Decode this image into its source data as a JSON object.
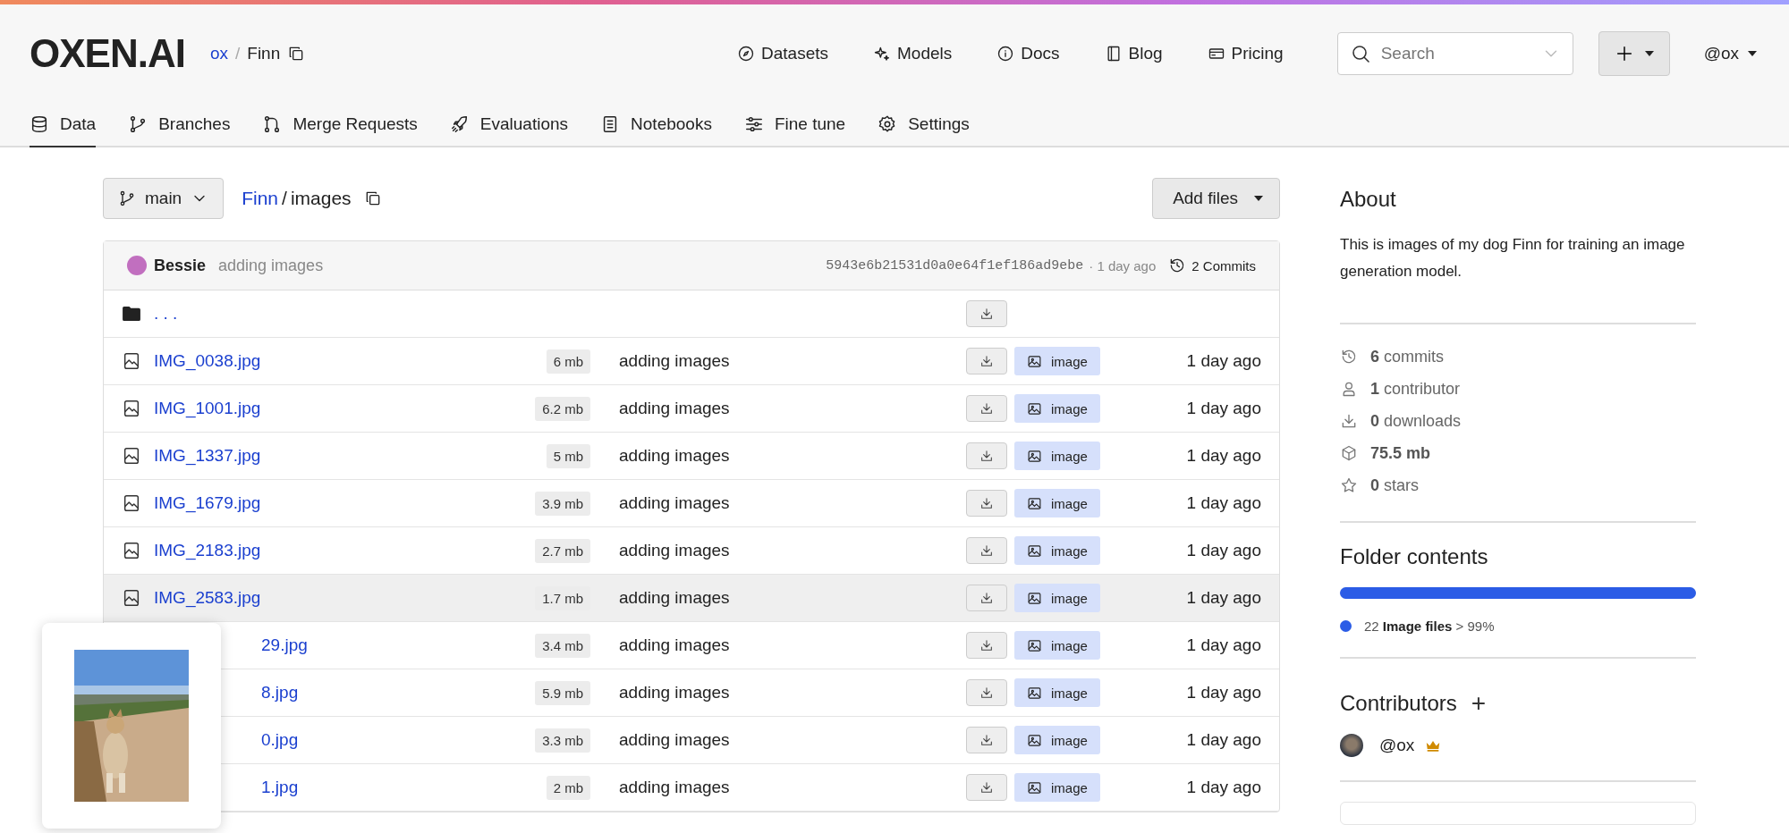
{
  "header": {
    "logo": "OXEN.AI",
    "breadcrumb": {
      "owner": "ox",
      "separator": "/",
      "repo": "Finn"
    },
    "nav": [
      {
        "kind": "compass",
        "label": "Datasets"
      },
      {
        "kind": "sparkle",
        "label": "Models"
      },
      {
        "kind": "info",
        "label": "Docs"
      },
      {
        "kind": "book",
        "label": "Blog"
      },
      {
        "kind": "card",
        "label": "Pricing"
      }
    ],
    "search": {
      "placeholder": "Search"
    },
    "user": "@ox"
  },
  "tabs": [
    {
      "kind": "database",
      "label": "Data",
      "selected": true
    },
    {
      "kind": "branch",
      "label": "Branches",
      "selected": false
    },
    {
      "kind": "merge",
      "label": "Merge Requests",
      "selected": false
    },
    {
      "kind": "rocket",
      "label": "Evaluations",
      "selected": false
    },
    {
      "kind": "notebook",
      "label": "Notebooks",
      "selected": false
    },
    {
      "kind": "sliders",
      "label": "Fine tune",
      "selected": false
    },
    {
      "kind": "gear",
      "label": "Settings",
      "selected": false
    }
  ],
  "toolbar": {
    "branch": "main",
    "path": {
      "repo": "Finn",
      "separator": "/",
      "folder": "images"
    },
    "add_button": "Add files"
  },
  "commit": {
    "author": "Bessie",
    "message": "adding images",
    "hash": "5943e6b21531d0a0e64f1ef186ad9ebe",
    "time": "· 1 day ago",
    "commits": "2 Commits"
  },
  "files": [
    {
      "kind": "folder",
      "name": ". . .",
      "hovered": false
    },
    {
      "kind": "file",
      "name": "IMG_0038.jpg",
      "size": "6 mb",
      "message": "adding images",
      "type": "image",
      "time": "1 day ago",
      "hovered": false,
      "partial": false
    },
    {
      "kind": "file",
      "name": "IMG_1001.jpg",
      "size": "6.2 mb",
      "message": "adding images",
      "type": "image",
      "time": "1 day ago",
      "hovered": false,
      "partial": false
    },
    {
      "kind": "file",
      "name": "IMG_1337.jpg",
      "size": "5 mb",
      "message": "adding images",
      "type": "image",
      "time": "1 day ago",
      "hovered": false,
      "partial": false
    },
    {
      "kind": "file",
      "name": "IMG_1679.jpg",
      "size": "3.9 mb",
      "message": "adding images",
      "type": "image",
      "time": "1 day ago",
      "hovered": false,
      "partial": false
    },
    {
      "kind": "file",
      "name": "IMG_2183.jpg",
      "size": "2.7 mb",
      "message": "adding images",
      "type": "image",
      "time": "1 day ago",
      "hovered": false,
      "partial": false
    },
    {
      "kind": "file",
      "name": "IMG_2583.jpg",
      "size": "1.7 mb",
      "message": "adding images",
      "type": "image",
      "time": "1 day ago",
      "hovered": true,
      "partial": false
    },
    {
      "kind": "file",
      "name": "29.jpg",
      "size": "3.4 mb",
      "message": "adding images",
      "type": "image",
      "time": "1 day ago",
      "hovered": false,
      "partial": true
    },
    {
      "kind": "file",
      "name": "8.jpg",
      "size": "5.9 mb",
      "message": "adding images",
      "type": "image",
      "time": "1 day ago",
      "hovered": false,
      "partial": true
    },
    {
      "kind": "file",
      "name": "0.jpg",
      "size": "3.3 mb",
      "message": "adding images",
      "type": "image",
      "time": "1 day ago",
      "hovered": false,
      "partial": true
    },
    {
      "kind": "file",
      "name": "1.jpg",
      "size": "2 mb",
      "message": "adding images",
      "type": "image",
      "time": "1 day ago",
      "hovered": false,
      "partial": true
    }
  ],
  "sidebar": {
    "about_title": "About",
    "description": "This is images of my dog Finn for training an image generation model.",
    "stats": [
      {
        "kind": "history",
        "text": "**6** commits"
      },
      {
        "kind": "person",
        "text": "**1** contributor"
      },
      {
        "kind": "download",
        "text": "**0** downloads"
      },
      {
        "kind": "box",
        "text": "**75.5 mb**"
      },
      {
        "kind": "star",
        "text": "**0** stars"
      }
    ],
    "folder_title": "Folder contents",
    "folder_bar": {
      "level": 1.0,
      "color": "#2b5ce6"
    },
    "legend": [
      {
        "color": "#2b5ce6",
        "text": "22 **Image files** > 99%"
      }
    ],
    "contributors_title": "Contributors",
    "add": "+",
    "contributors": [
      {
        "handle": "@ox",
        "owner": true
      }
    ]
  }
}
